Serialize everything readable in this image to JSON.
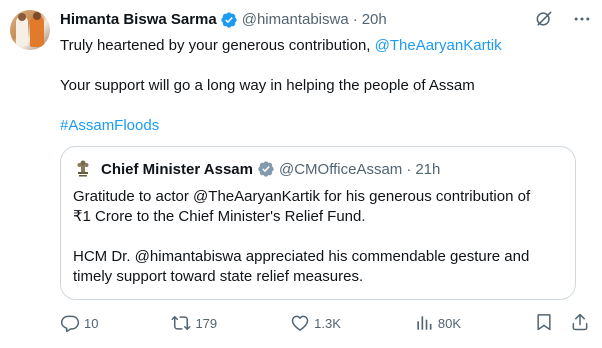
{
  "author": {
    "name": "Himanta Biswa Sarma",
    "handle": "@himantabiswa",
    "time": "20h"
  },
  "tweet": {
    "line1_text": "Truly heartened by your generous contribution, ",
    "line1_mention": "@TheAaryanKartik",
    "line2": "Your support will go a long way in helping the people of Assam",
    "hashtag": "#AssamFloods"
  },
  "quoted": {
    "name": "Chief Minister Assam",
    "handle": "@CMOfficeAssam",
    "time": "21h",
    "para1_line1": "Gratitude to actor @TheAaryanKartik for his generous contribution of",
    "para1_line2": "₹1 Crore to the Chief Minister's Relief Fund.",
    "para2_line1": "HCM Dr. @himantabiswa appreciated his commendable gesture and",
    "para2_line2": "timely support toward state relief measures."
  },
  "actions": {
    "replies": "10",
    "reposts": "179",
    "likes": "1.3K",
    "views": "80K"
  },
  "colors": {
    "accent": "#1d9bf0",
    "muted": "#536471",
    "border": "#cfd9de"
  },
  "icons": [
    "grok-icon",
    "more-icon",
    "verified-badge-icon",
    "state-emblem-icon",
    "reply-icon",
    "repost-icon",
    "like-icon",
    "views-icon",
    "bookmark-icon",
    "share-icon"
  ]
}
